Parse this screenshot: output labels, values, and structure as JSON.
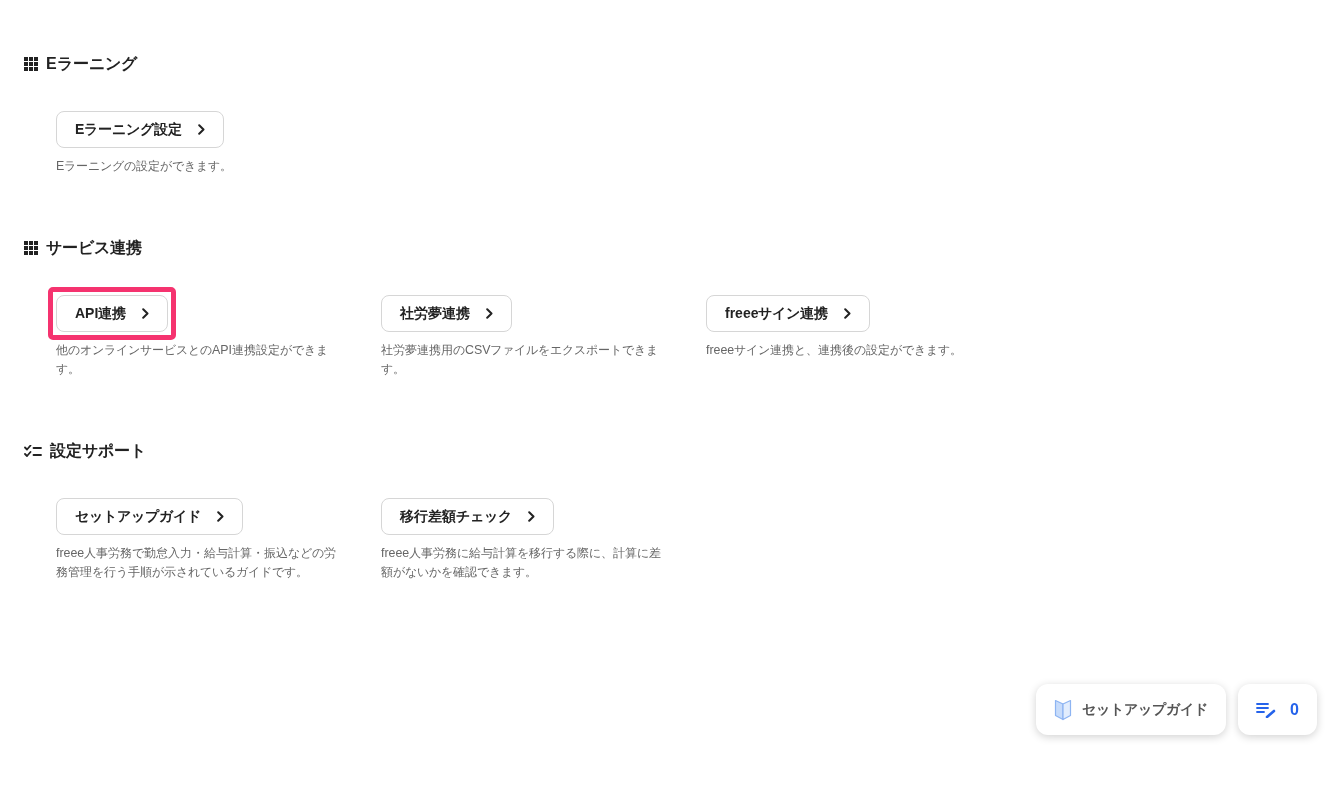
{
  "sections": [
    {
      "kind": "grid",
      "title": "Eラーニング",
      "items": [
        {
          "label": "Eラーニング設定",
          "description": "Eラーニングの設定ができます。",
          "highlighted": false
        }
      ]
    },
    {
      "kind": "grid",
      "title": "サービス連携",
      "items": [
        {
          "label": "API連携",
          "description": "他のオンラインサービスとのAPI連携設定ができます。",
          "highlighted": true
        },
        {
          "label": "社労夢連携",
          "description": "社労夢連携用のCSVファイルをエクスポートできます。",
          "highlighted": false
        },
        {
          "label": "freeeサイン連携",
          "description": "freeeサイン連携と、連携後の設定ができます。",
          "highlighted": false
        }
      ]
    },
    {
      "kind": "checklist",
      "title": "設定サポート",
      "items": [
        {
          "label": "セットアップガイド",
          "description": "freee人事労務で勤怠入力・給与計算・振込などの労務管理を行う手順が示されているガイドです。",
          "highlighted": false
        },
        {
          "label": "移行差額チェック",
          "description": "freee人事労務に給与計算を移行する際に、計算に差額がないかを確認できます。",
          "highlighted": false
        }
      ]
    }
  ],
  "floating_buttons": {
    "setup_guide": {
      "label": "セットアップガイド"
    },
    "notes": {
      "count": "0"
    }
  }
}
